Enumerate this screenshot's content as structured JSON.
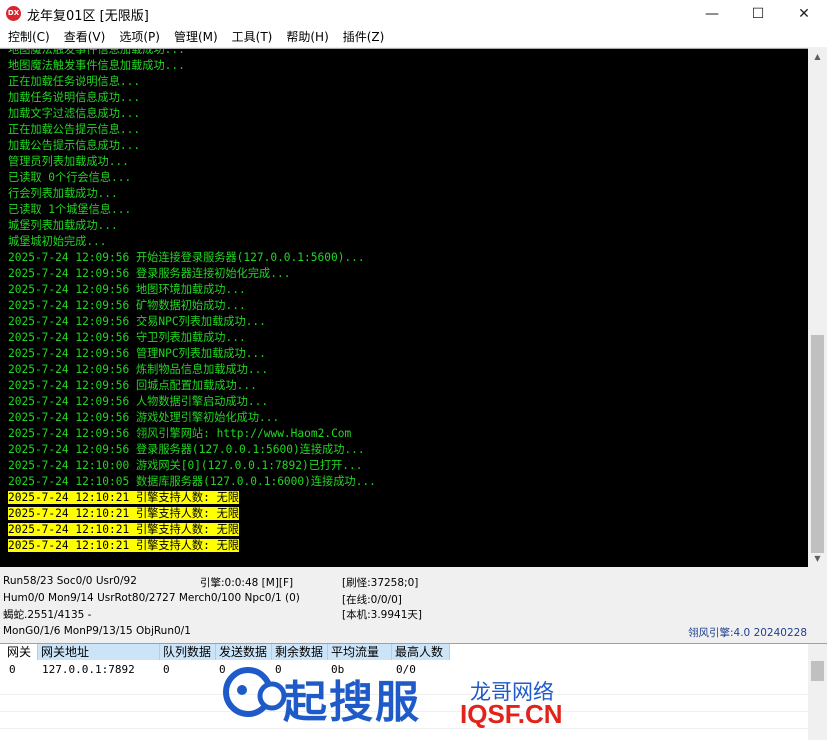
{
  "window": {
    "icon_label": "DX",
    "title": "龙年复01区 [无限版]",
    "minimize": "—",
    "maximize": "☐",
    "close": "✕"
  },
  "menu": [
    "控制(C)",
    "查看(V)",
    "选项(P)",
    "管理(M)",
    "工具(T)",
    "帮助(H)",
    "插件(Z)"
  ],
  "console": {
    "lines": [
      "地图魔法触发事件信息加载成功...",
      "地图魔法触发事件信息加载成功...",
      "正在加载任务说明信息...",
      "加载任务说明信息成功...",
      "加载文字过滤信息成功...",
      "正在加载公告提示信息...",
      "加载公告提示信息成功...",
      "管理员列表加载成功...",
      "已读取 0个行会信息...",
      "行会列表加载成功...",
      "已读取 1个城堡信息...",
      "城堡列表加载成功...",
      "城堡城初始完成...",
      "2025-7-24 12:09:56 开始连接登录服务器(127.0.0.1:5600)...",
      "2025-7-24 12:09:56 登录服务器连接初始化完成...",
      "2025-7-24 12:09:56 地图环境加载成功...",
      "2025-7-24 12:09:56 矿物数据初始成功...",
      "2025-7-24 12:09:56 交易NPC列表加载成功...",
      "2025-7-24 12:09:56 守卫列表加载成功...",
      "2025-7-24 12:09:56 管理NPC列表加载成功...",
      "2025-7-24 12:09:56 炼制物品信息加载成功...",
      "2025-7-24 12:09:56 回城点配置加载成功...",
      "2025-7-24 12:09:56 人物数据引擎启动成功...",
      "2025-7-24 12:09:56 游戏处理引擎初始化成功...",
      "2025-7-24 12:09:56 翎风引擎网站: http://www.Haom2.Com",
      "2025-7-24 12:09:56 登录服务器(127.0.0.1:5600)连接成功...",
      "2025-7-24 12:10:00 游戏网关[0](127.0.0.1:7892)已打开...",
      "2025-7-24 12:10:05 数据库服务器(127.0.0.1:6000)连接成功..."
    ],
    "highlighted": [
      "2025-7-24 12:10:21 引擎支持人数: 无限",
      "2025-7-24 12:10:21 引擎支持人数: 无限",
      "2025-7-24 12:10:21 引擎支持人数: 无限",
      "2025-7-24 12:10:21 引擎支持人数: 无限"
    ]
  },
  "status": {
    "run": "Run58/23 Soc0/0 Usr0/92",
    "engine": "引擎:0:0:48 [M][F]",
    "monsters": "[刷怪:37258;0]",
    "hum": "Hum0/0 Mon9/14 UsrRot80/2727 Merch0/100 Npc0/1 (0)",
    "online": "[在线:0/0/0]",
    "scorpion": "蝎蛇.2551/4135 -",
    "local": "[本机:3.9941天]",
    "mon": "MonG0/1/6 MonP9/13/15 ObjRun0/1",
    "version": "翎风引擎:4.0 20240228"
  },
  "gateway_table": {
    "headers": [
      "网关",
      "网关地址",
      "队列数据",
      "发送数据",
      "剩余数据",
      "平均流量",
      "最高人数"
    ],
    "rows": [
      [
        "0",
        "127.0.0.1:7892",
        "0",
        "0",
        "0",
        "0b",
        "0/0"
      ]
    ]
  },
  "watermark": {
    "main": "起搜服",
    "sub1": "龙哥网络",
    "sub2": "IQSF.CN"
  },
  "colors": {
    "console_text": "#22d622",
    "highlight_bg": "#ffff00",
    "watermark_blue": "#1f5bc8",
    "watermark_red": "#e2231a"
  }
}
